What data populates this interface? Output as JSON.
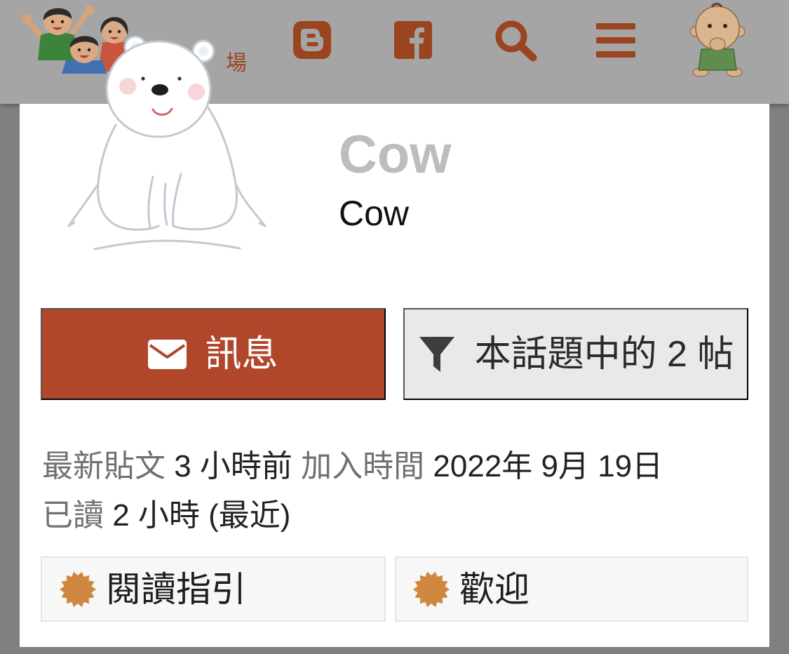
{
  "header": {
    "logo_lettering": "場",
    "links": [
      {
        "icon": "blogger-icon"
      },
      {
        "icon": "facebook-icon"
      },
      {
        "icon": "search-icon"
      },
      {
        "icon": "menu-icon"
      }
    ],
    "current_user_avatar": "baby-avatar"
  },
  "user_card": {
    "avatar_icon": "polar-bear-avatar",
    "username": "Cow",
    "name": "Cow",
    "actions": {
      "message": {
        "label": "訊息",
        "icon": "envelope-icon"
      },
      "filter": {
        "label": "本話題中的 2 帖",
        "icon": "filter-icon"
      }
    },
    "metadata": {
      "last_post": {
        "label": "最新貼文",
        "value": "3 小時前"
      },
      "joined": {
        "label": "加入時間",
        "value": "2022年 9月 19日"
      },
      "read": {
        "label": "已讀",
        "value": "2 小時 (最近)"
      }
    },
    "badges": [
      {
        "name": "閱讀指引",
        "icon": "certificate-icon"
      },
      {
        "name": "歡迎",
        "icon": "certificate-icon"
      }
    ]
  },
  "colors": {
    "header_bg": "#a5a5a5",
    "page_bg": "#808080",
    "brand": "#b0462a",
    "header_icon": "#9a4520",
    "muted_text": "#707070",
    "username_text": "#bdbdbd",
    "badge_icon": "#d0873f",
    "secondary_button_bg": "#e9e9e9",
    "text": "#222222",
    "bear_outline": "#c2c9d2"
  }
}
